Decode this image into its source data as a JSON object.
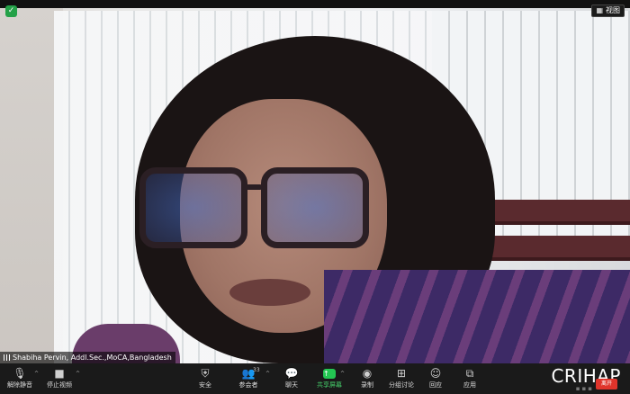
{
  "window": {
    "view_label": "视图",
    "participant_name": "Shabiha Pervin, Addl.Sec.,MoCA,Bangladesh"
  },
  "toolbar": {
    "unmute_label": "解除静音",
    "stop_video_label": "停止视频",
    "security_label": "安全",
    "participants_label": "参会者",
    "participants_count": "33",
    "chat_label": "聊天",
    "share_label": "共享屏幕",
    "record_label": "录制",
    "breakout_label": "分组讨论",
    "reactions_label": "回应",
    "apps_label": "应用"
  },
  "brand": {
    "logo_text": "CRIHAP",
    "end_label": "离开"
  },
  "colors": {
    "toolbar_bg": "#1a1a1a",
    "share_green": "#23c552",
    "end_red": "#e0342b",
    "shield_green": "#24a148"
  }
}
